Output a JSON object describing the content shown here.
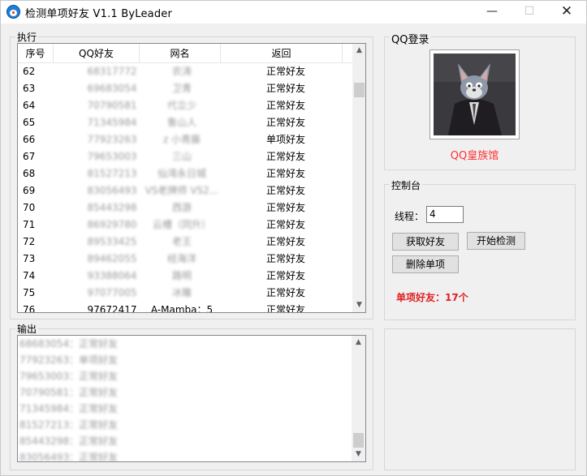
{
  "window": {
    "title": "检测单项好友  V1.1   ByLeader",
    "minimize": "—",
    "maximize": "☐",
    "close": "✕"
  },
  "exec": {
    "label": "执行",
    "columns": [
      "序号",
      "QQ好友",
      "网名",
      "返回"
    ],
    "rows": [
      {
        "no": "62",
        "qq": "68317772",
        "name": "农涛",
        "status": "正常好友"
      },
      {
        "no": "63",
        "qq": "69683054",
        "name": "卫青",
        "status": "正常好友"
      },
      {
        "no": "64",
        "qq": "70790581",
        "name": "代立少",
        "status": "正常好友"
      },
      {
        "no": "65",
        "qq": "71345984",
        "name": "鲁山人",
        "status": "正常好友"
      },
      {
        "no": "66",
        "qq": "77923263",
        "name": "z 小青藤",
        "status": "单项好友"
      },
      {
        "no": "67",
        "qq": "79653003",
        "name": "三山",
        "status": "正常好友"
      },
      {
        "no": "68",
        "qq": "81527213",
        "name": "仙湾永日城",
        "status": "正常好友"
      },
      {
        "no": "69",
        "qq": "83056493",
        "name": "VS老牌师 VS2...",
        "status": "正常好友"
      },
      {
        "no": "70",
        "qq": "85443298",
        "name": "西游",
        "status": "正常好友"
      },
      {
        "no": "71",
        "qq": "86929780",
        "name": "云槽（同升）",
        "status": "正常好友"
      },
      {
        "no": "72",
        "qq": "89533425",
        "name": "老王",
        "status": "正常好友"
      },
      {
        "no": "73",
        "qq": "89462055",
        "name": "经海洋",
        "status": "正常好友"
      },
      {
        "no": "74",
        "qq": "93388064",
        "name": "路明",
        "status": "正常好友"
      },
      {
        "no": "75",
        "qq": "97077005",
        "name": "冰雕",
        "status": "正常好友"
      },
      {
        "no": "76",
        "qq": "97672417",
        "name": "A-Mamba：5",
        "status": "正常好友"
      }
    ]
  },
  "output": {
    "label": "输出",
    "lines": [
      "68683054：正常好友",
      "77923263：单项好友",
      "79653003：正常好友",
      "70790581：正常好友",
      "71345984：正常好友",
      "81527213：正常好友",
      "85443298：正常好友",
      "83056493：正常好友"
    ]
  },
  "login": {
    "label": "QQ登录",
    "nickname": "QQ皇族馆"
  },
  "console": {
    "label": "控制台",
    "thread_label": "线程：",
    "thread_value": "4",
    "btn_get_friends": "获取好友",
    "btn_start": "开始检测",
    "btn_delete": "删除单项",
    "result": "单项好友：17个"
  },
  "icons": {
    "scroll_up": "▲",
    "scroll_down": "▼"
  },
  "colors": {
    "nickname": "#ff3030",
    "result": "#e02020"
  }
}
